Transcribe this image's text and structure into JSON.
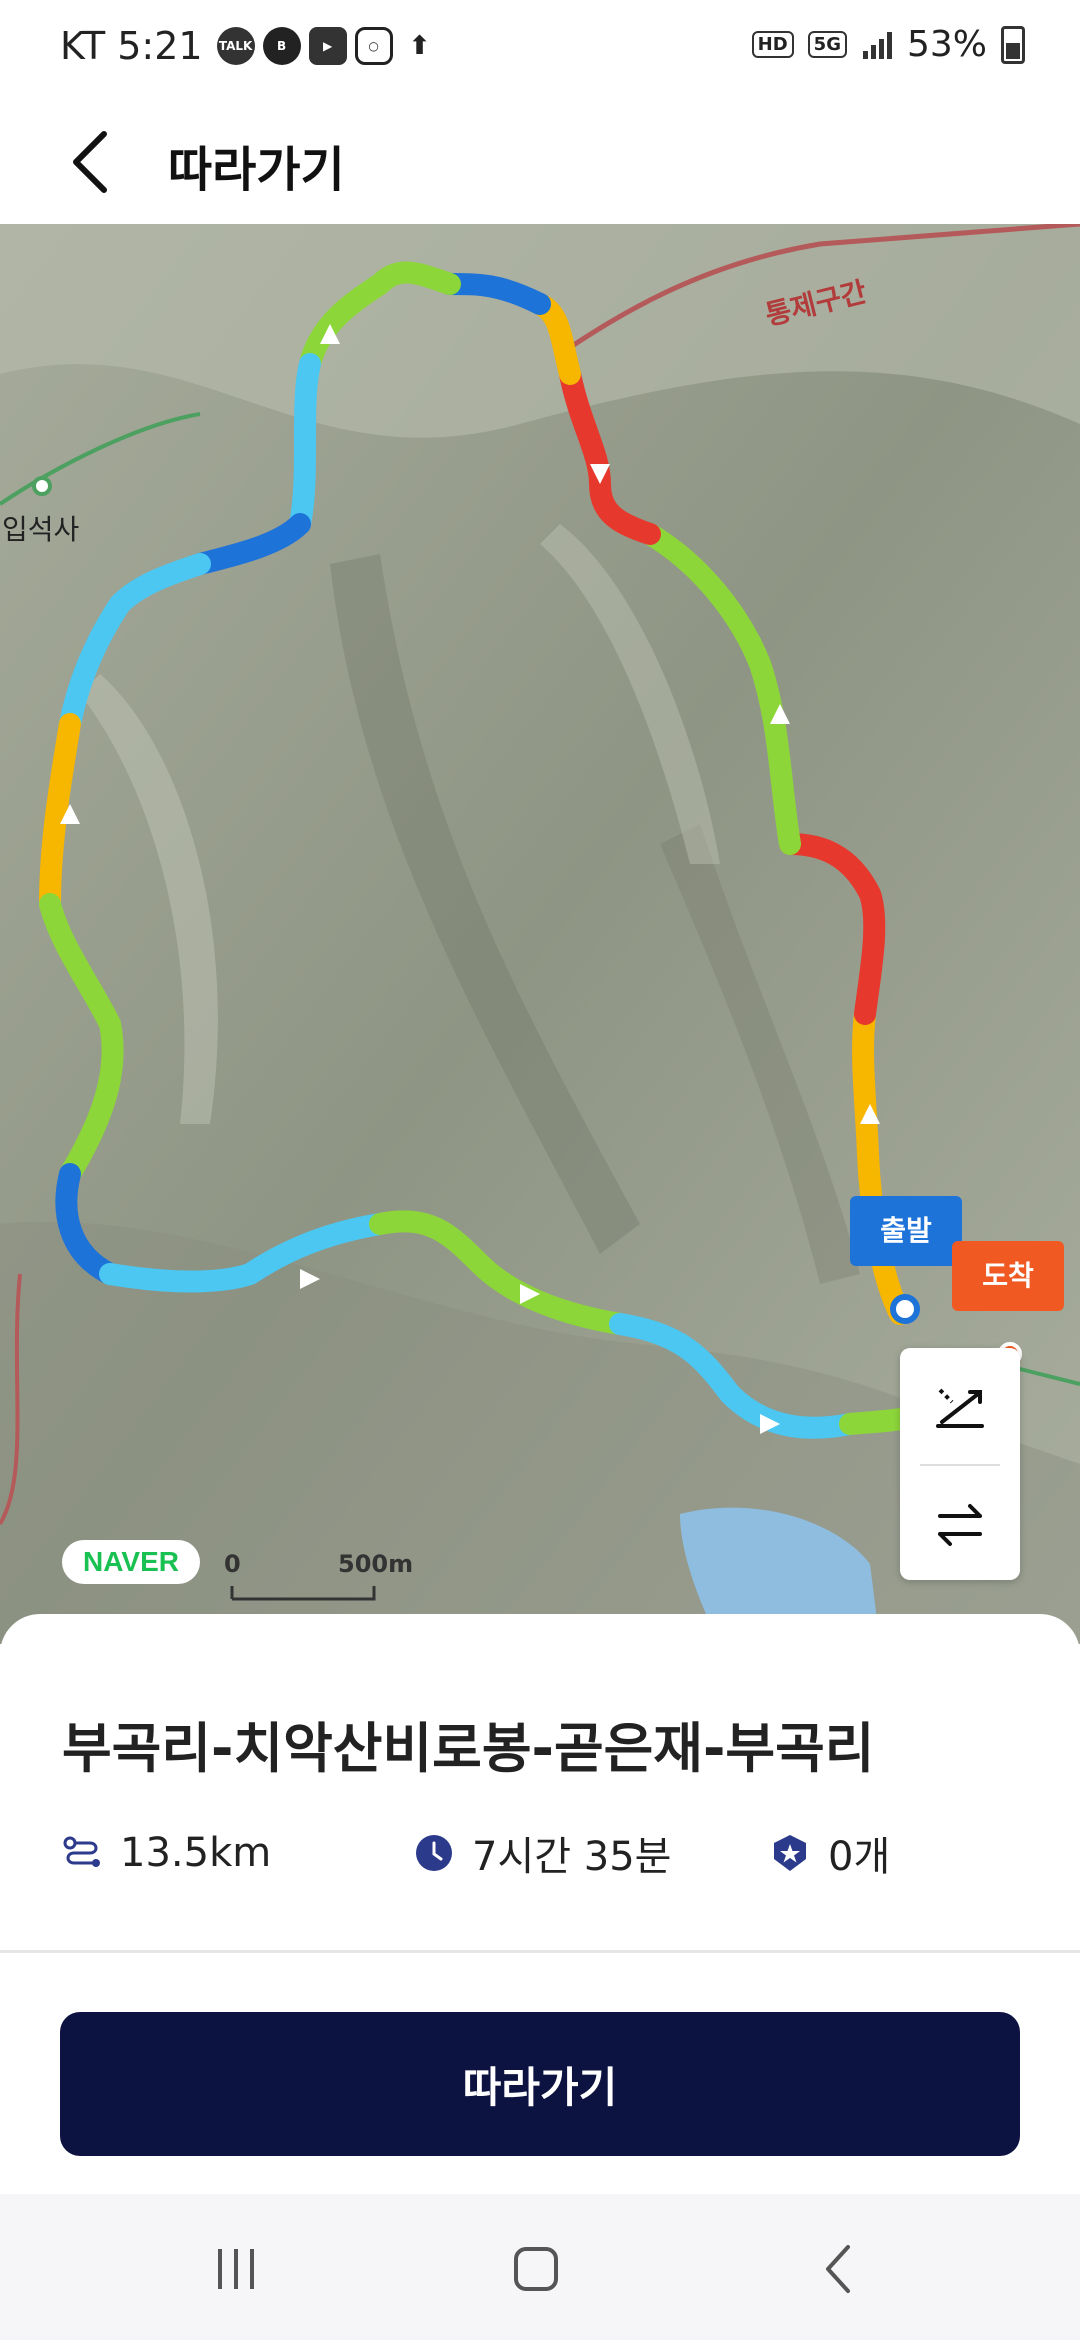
{
  "status_bar": {
    "carrier_time": "KT 5:21",
    "icons": [
      "talk-icon",
      "b-icon",
      "youtube-icon",
      "instagram-icon",
      "app-icon"
    ],
    "right_badges": [
      "HD",
      "5G"
    ],
    "battery": "53%"
  },
  "header": {
    "title": "따라가기"
  },
  "map": {
    "labels": {
      "restricted": "통제구간",
      "temple": "입석사"
    },
    "start_label": "출발",
    "end_label": "도착",
    "naver_logo": "NAVER",
    "scale_zero": "0",
    "scale_distance": "500m"
  },
  "route": {
    "name": "부곡리-치악산비로봉-곧은재-부곡리",
    "distance": "13.5km",
    "duration": "7시간 35분",
    "stamps": "0개"
  },
  "actions": {
    "follow_label": "따라가기"
  },
  "colors": {
    "primary": "#0c1340",
    "start_pin": "#1e73d8",
    "end_pin": "#f05a22",
    "route_green": "#8dd63a",
    "route_blue": "#4cc7f2",
    "route_orange": "#f7b600",
    "route_red": "#e6382d"
  }
}
